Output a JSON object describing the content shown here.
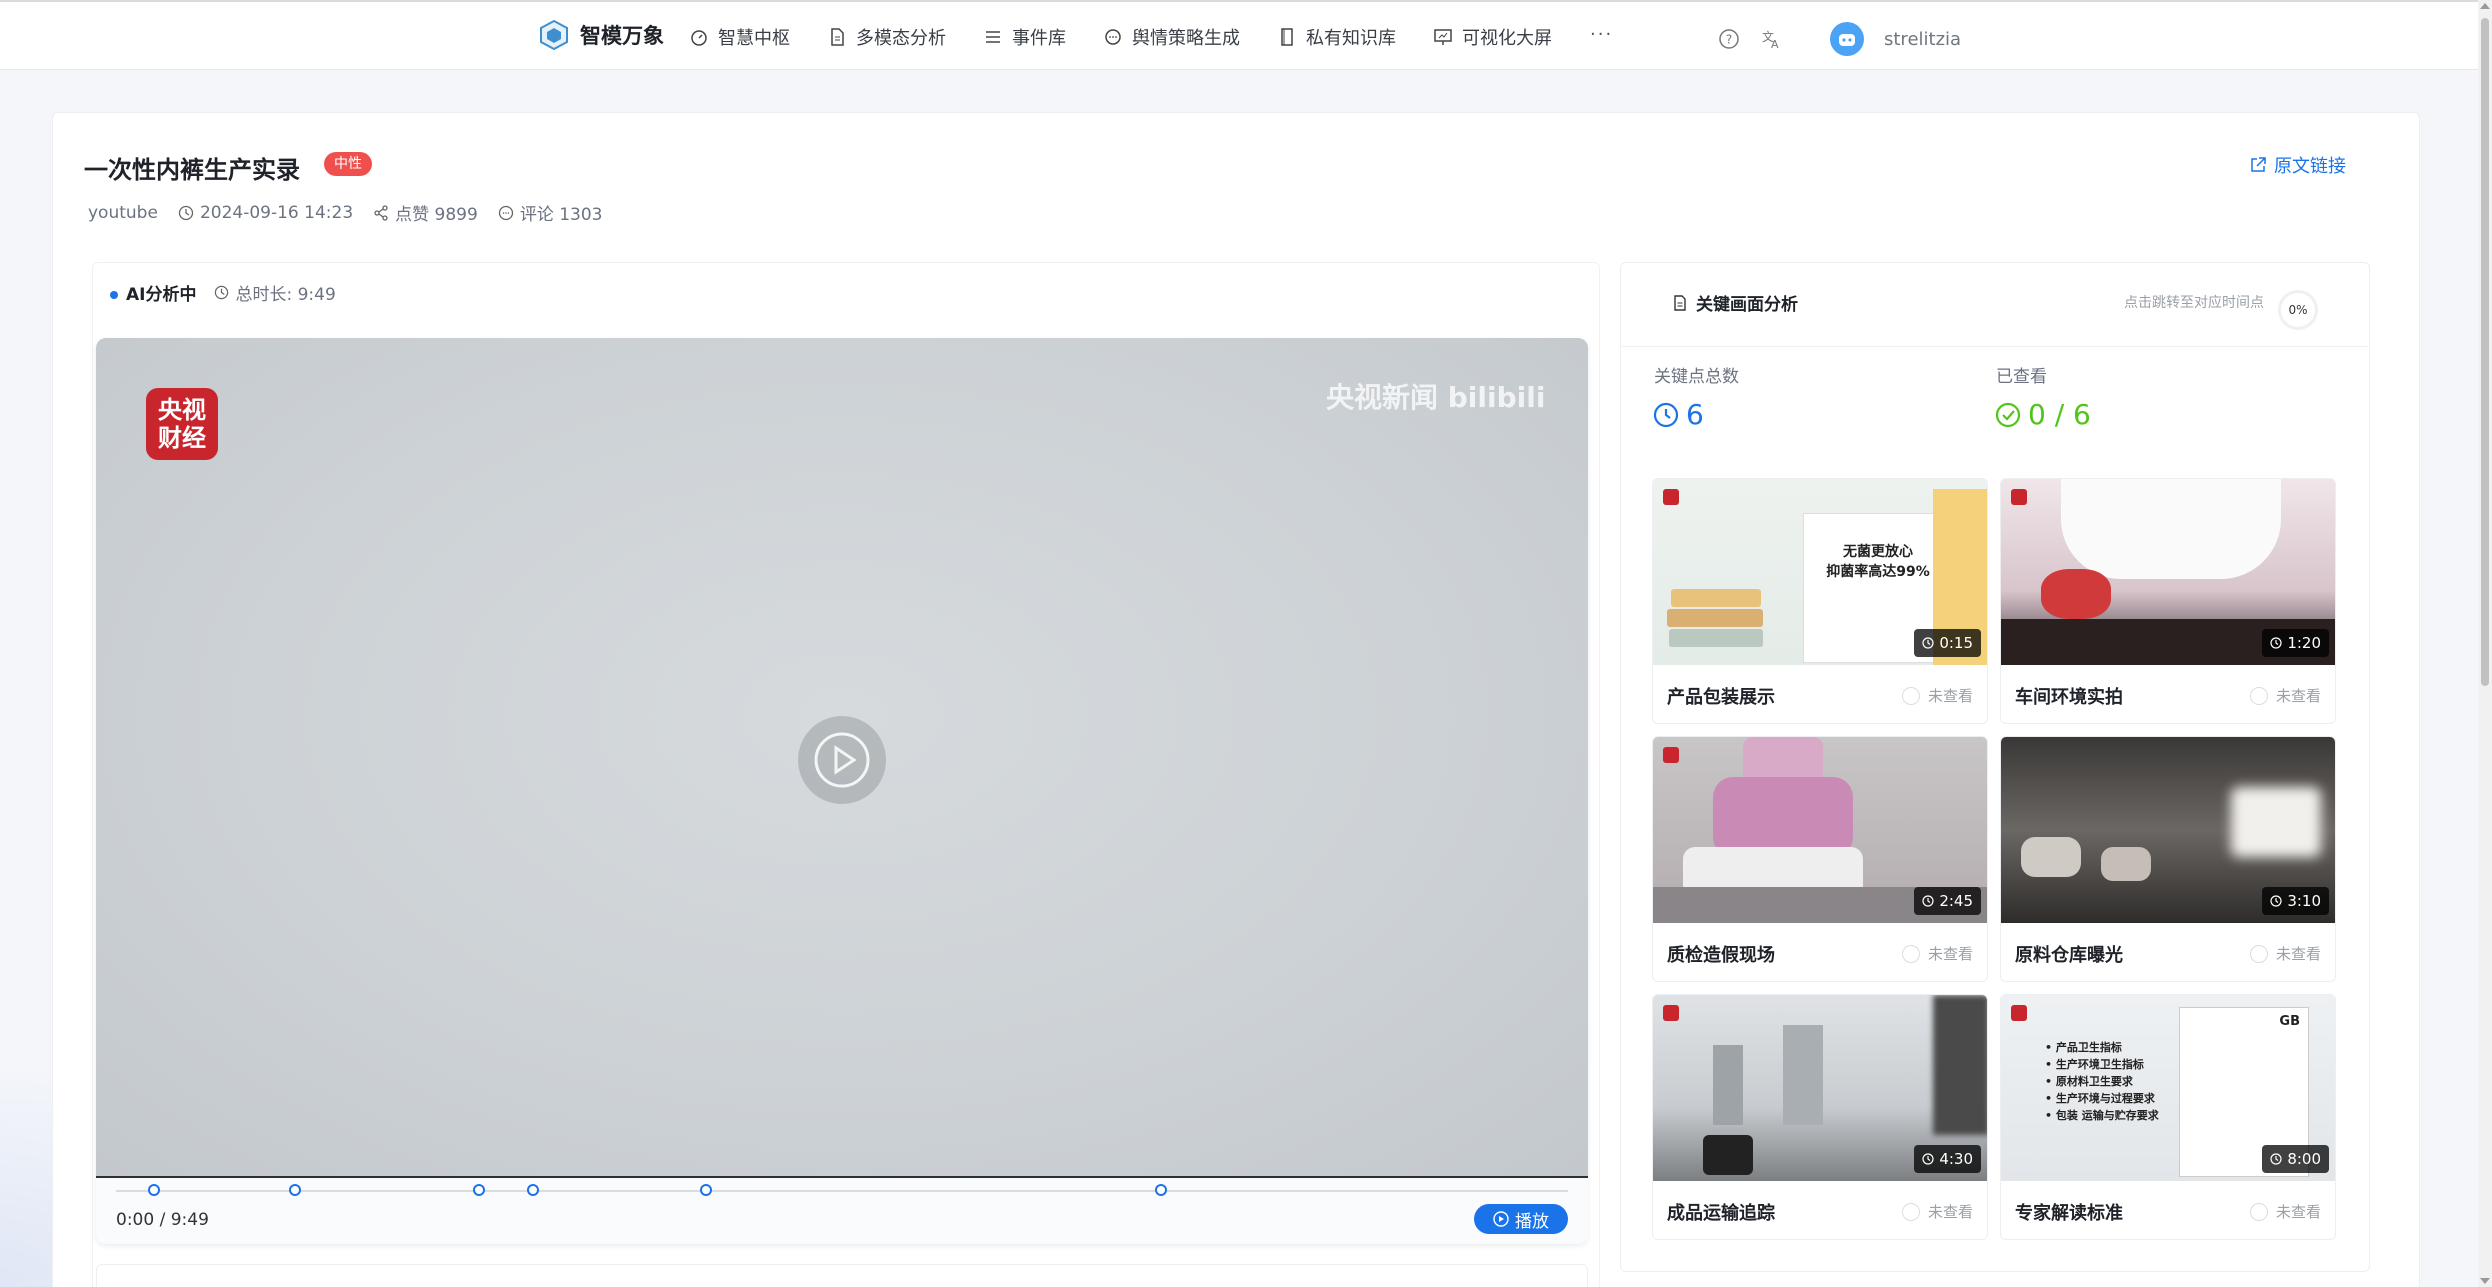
{
  "header": {
    "brand": "智模万象",
    "nav": [
      {
        "label": "智慧中枢",
        "icon": "dashboard-icon"
      },
      {
        "label": "多模态分析",
        "icon": "document-icon"
      },
      {
        "label": "事件库",
        "icon": "list-icon"
      },
      {
        "label": "舆情策略生成",
        "icon": "chat-icon"
      },
      {
        "label": "私有知识库",
        "icon": "book-icon"
      },
      {
        "label": "可视化大屏",
        "icon": "screen-icon"
      }
    ],
    "more": "···",
    "username": "strelitzia"
  },
  "article": {
    "title": "一次性内裤生产实录",
    "tag": "中性",
    "origin_link": "原文链接",
    "source": "youtube",
    "datetime": "2024-09-16 14:23",
    "likes": "点赞 9899",
    "comments": "评论 1303"
  },
  "analysis": {
    "status": "AI分析中",
    "duration": "总时长: 9:49"
  },
  "player": {
    "cctv_logo": "央视财经",
    "watermark": "央视新闻 bilibili",
    "time": "0:00 / 9:49",
    "play_label": "播放",
    "markers_fraction": [
      0.026,
      0.123,
      0.25,
      0.287,
      0.406,
      0.72
    ]
  },
  "keyframes": {
    "title": "关键画面分析",
    "hint": "点击跳转至对应时间点",
    "progress": "0%",
    "total_label": "关键点总数",
    "total_value": "6",
    "viewed_label": "已查看",
    "viewed_value": "0 / 6",
    "items": [
      {
        "caption": "产品包装展示",
        "time": "0:15",
        "status": "未查看",
        "overlay": [
          "无菌更放心",
          "抑菌率高达99%"
        ]
      },
      {
        "caption": "车间环境实拍",
        "time": "1:20",
        "status": "未查看"
      },
      {
        "caption": "质检造假现场",
        "time": "2:45",
        "status": "未查看"
      },
      {
        "caption": "原料仓库曝光",
        "time": "3:10",
        "status": "未查看"
      },
      {
        "caption": "成品运输追踪",
        "time": "4:30",
        "status": "未查看"
      },
      {
        "caption": "专家解读标准",
        "time": "8:00",
        "status": "未查看",
        "overlay": [
          "产品卫生指标",
          "生产环境卫生指标",
          "原材料卫生要求",
          "生产环境与过程要求",
          "包装 运输与贮存要求",
          "GB"
        ]
      }
    ]
  },
  "colors": {
    "accent": "#1a73e8",
    "tag": "#f0504d",
    "success": "#52c41a"
  }
}
